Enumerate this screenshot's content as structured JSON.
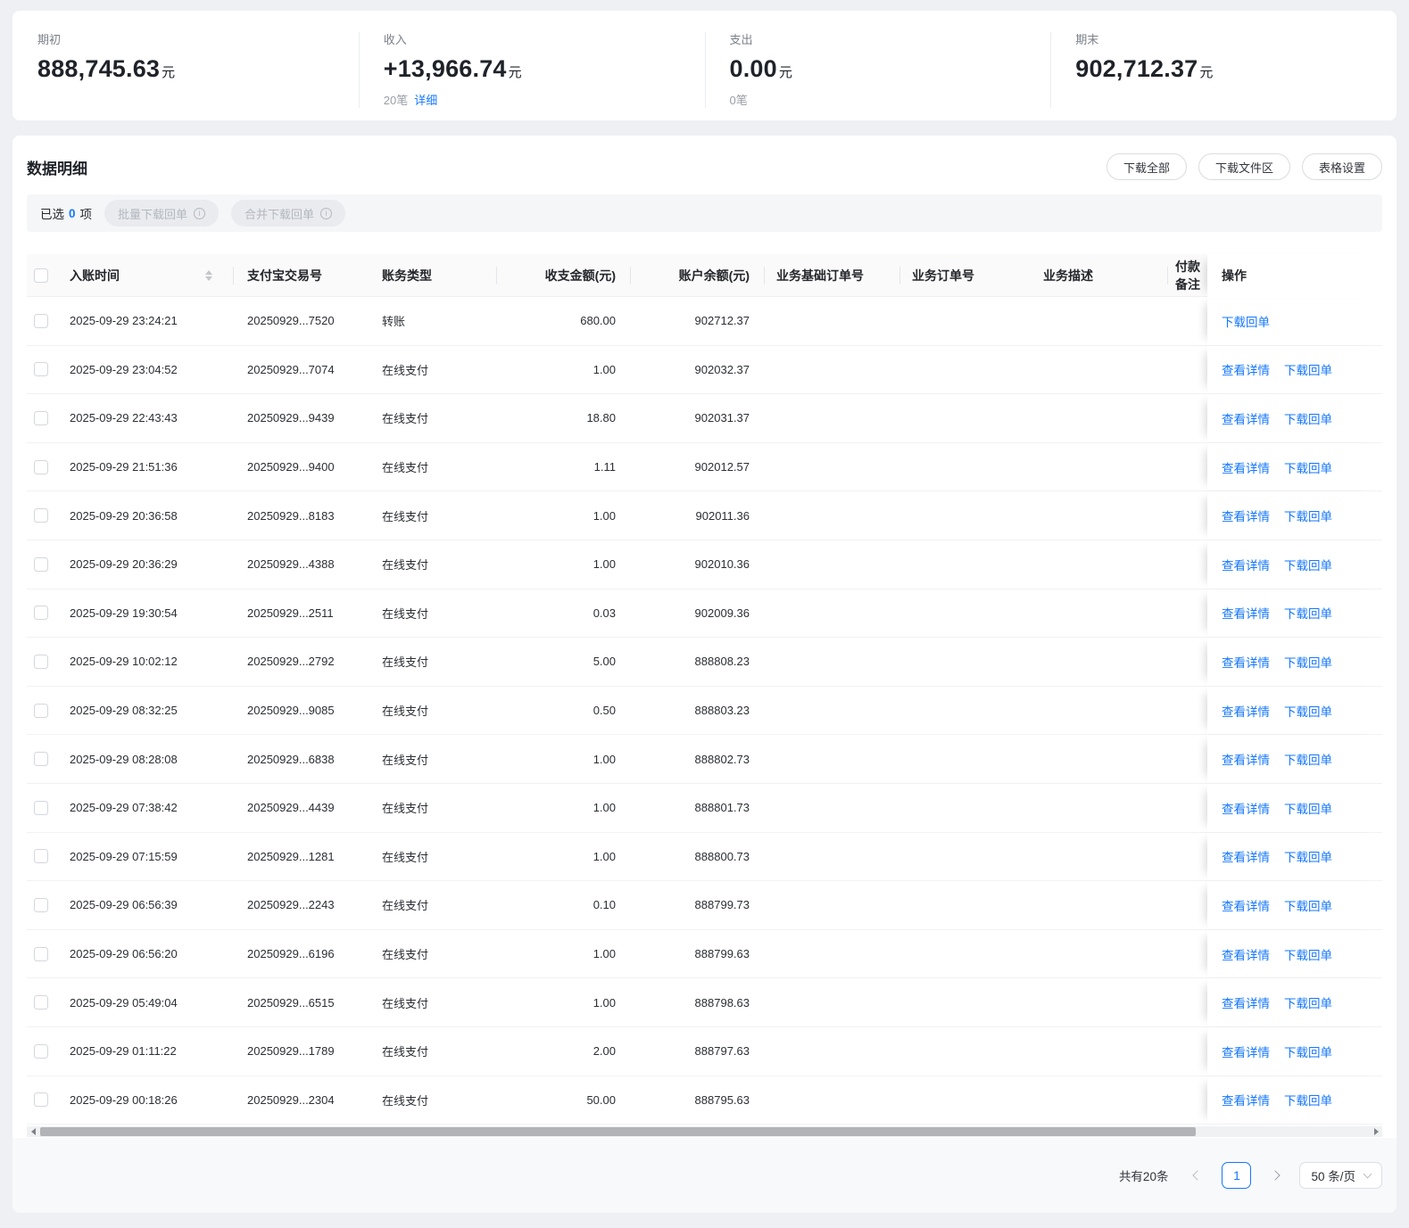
{
  "colors": {
    "accent": "#1677ff",
    "page_bg": "#eef0f4"
  },
  "summary": {
    "cards": [
      {
        "label": "期初",
        "value": "888,745.63",
        "unit": "元"
      },
      {
        "label": "收入",
        "value": "+13,966.74",
        "unit": "元",
        "count": "20笔",
        "link": "详细"
      },
      {
        "label": "支出",
        "value": "0.00",
        "unit": "元",
        "count": "0笔"
      },
      {
        "label": "期末",
        "value": "902,712.37",
        "unit": "元"
      }
    ]
  },
  "section": {
    "title": "数据明细",
    "toolbar": [
      "下载全部",
      "下载文件区",
      "表格设置"
    ],
    "selection": {
      "prefix": "已选",
      "count": "0",
      "suffix": "项",
      "batch_button": "批量下载回单",
      "merge_button": "合并下载回单",
      "info_glyph": "i"
    }
  },
  "table": {
    "columns": {
      "time": "入账时间",
      "txn": "支付宝交易号",
      "type": "账务类型",
      "amount": "收支金额(元)",
      "balance": "账户余额(元)",
      "base_order": "业务基础订单号",
      "order": "业务订单号",
      "desc": "业务描述",
      "payer": "付款备注",
      "actions": "操作"
    },
    "action_labels": {
      "detail": "查看详情",
      "download": "下载回单"
    },
    "rows": [
      {
        "time": "2025-09-29 23:24:21",
        "txn": "20250929...7520",
        "type": "转账",
        "amount": "680.00",
        "balance": "902712.37",
        "actions": [
          "download"
        ]
      },
      {
        "time": "2025-09-29 23:04:52",
        "txn": "20250929...7074",
        "type": "在线支付",
        "amount": "1.00",
        "balance": "902032.37",
        "actions": [
          "detail",
          "download"
        ]
      },
      {
        "time": "2025-09-29 22:43:43",
        "txn": "20250929...9439",
        "type": "在线支付",
        "amount": "18.80",
        "balance": "902031.37",
        "actions": [
          "detail",
          "download"
        ]
      },
      {
        "time": "2025-09-29 21:51:36",
        "txn": "20250929...9400",
        "type": "在线支付",
        "amount": "1.11",
        "balance": "902012.57",
        "actions": [
          "detail",
          "download"
        ]
      },
      {
        "time": "2025-09-29 20:36:58",
        "txn": "20250929...8183",
        "type": "在线支付",
        "amount": "1.00",
        "balance": "902011.36",
        "actions": [
          "detail",
          "download"
        ]
      },
      {
        "time": "2025-09-29 20:36:29",
        "txn": "20250929...4388",
        "type": "在线支付",
        "amount": "1.00",
        "balance": "902010.36",
        "actions": [
          "detail",
          "download"
        ]
      },
      {
        "time": "2025-09-29 19:30:54",
        "txn": "20250929...2511",
        "type": "在线支付",
        "amount": "0.03",
        "balance": "902009.36",
        "actions": [
          "detail",
          "download"
        ]
      },
      {
        "time": "2025-09-29 10:02:12",
        "txn": "20250929...2792",
        "type": "在线支付",
        "amount": "5.00",
        "balance": "888808.23",
        "actions": [
          "detail",
          "download"
        ]
      },
      {
        "time": "2025-09-29 08:32:25",
        "txn": "20250929...9085",
        "type": "在线支付",
        "amount": "0.50",
        "balance": "888803.23",
        "actions": [
          "detail",
          "download"
        ]
      },
      {
        "time": "2025-09-29 08:28:08",
        "txn": "20250929...6838",
        "type": "在线支付",
        "amount": "1.00",
        "balance": "888802.73",
        "actions": [
          "detail",
          "download"
        ]
      },
      {
        "time": "2025-09-29 07:38:42",
        "txn": "20250929...4439",
        "type": "在线支付",
        "amount": "1.00",
        "balance": "888801.73",
        "actions": [
          "detail",
          "download"
        ]
      },
      {
        "time": "2025-09-29 07:15:59",
        "txn": "20250929...1281",
        "type": "在线支付",
        "amount": "1.00",
        "balance": "888800.73",
        "actions": [
          "detail",
          "download"
        ]
      },
      {
        "time": "2025-09-29 06:56:39",
        "txn": "20250929...2243",
        "type": "在线支付",
        "amount": "0.10",
        "balance": "888799.73",
        "actions": [
          "detail",
          "download"
        ]
      },
      {
        "time": "2025-09-29 06:56:20",
        "txn": "20250929...6196",
        "type": "在线支付",
        "amount": "1.00",
        "balance": "888799.63",
        "actions": [
          "detail",
          "download"
        ]
      },
      {
        "time": "2025-09-29 05:49:04",
        "txn": "20250929...6515",
        "type": "在线支付",
        "amount": "1.00",
        "balance": "888798.63",
        "actions": [
          "detail",
          "download"
        ]
      },
      {
        "time": "2025-09-29 01:11:22",
        "txn": "20250929...1789",
        "type": "在线支付",
        "amount": "2.00",
        "balance": "888797.63",
        "actions": [
          "detail",
          "download"
        ]
      },
      {
        "time": "2025-09-29 00:18:26",
        "txn": "20250929...2304",
        "type": "在线支付",
        "amount": "50.00",
        "balance": "888795.63",
        "actions": [
          "detail",
          "download"
        ]
      }
    ]
  },
  "pagination": {
    "total": "共有20条",
    "page": "1",
    "page_size": "50 条/页"
  }
}
